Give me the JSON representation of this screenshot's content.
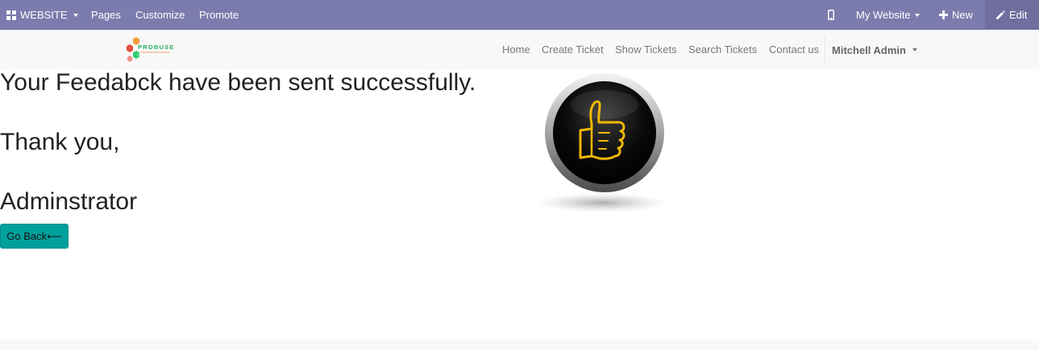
{
  "adminbar": {
    "website_menu": "WEBSITE",
    "pages": "Pages",
    "customize": "Customize",
    "promote": "Promote",
    "my_website": "My Website",
    "new": "New",
    "edit": "Edit"
  },
  "navbar": {
    "logo_text": "PROBUSE",
    "logo_tagline": "STRENGTHENING BUSINESS",
    "links": [
      "Home",
      "Create Ticket",
      "Show Tickets",
      "Search Tickets",
      "Contact us"
    ],
    "user": "Mitchell Admin"
  },
  "content": {
    "line1": "Your Feedabck have been sent successfully.",
    "line2": "Thank you,",
    "line3": "Adminstrator",
    "back_button": "Go Back⟵"
  },
  "colors": {
    "adminbar_bg": "#7c7bad",
    "navbar_bg": "#f8f8f8",
    "button_bg": "#00a09d",
    "thumb_gold": "#f2b705"
  },
  "icons": [
    "apps-grid-icon",
    "mobile-preview-icon",
    "plus-icon",
    "pencil-icon",
    "thumbs-up-icon"
  ]
}
